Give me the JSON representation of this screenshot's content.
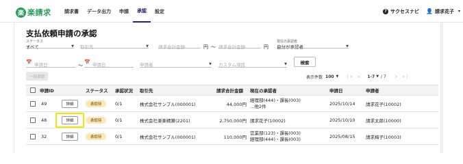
{
  "logo": {
    "mark": "楽",
    "text": "楽請求"
  },
  "nav": [
    {
      "label": "請求書",
      "active": false
    },
    {
      "label": "データ出力",
      "active": false
    },
    {
      "label": "申請",
      "active": false
    },
    {
      "label": "承認",
      "active": true
    },
    {
      "label": "設定",
      "active": false
    }
  ],
  "header_right": {
    "help_label": "サクセスナビ",
    "help_icon": "?",
    "user_name": "請求花子",
    "user_icon": "person-icon"
  },
  "page_title": "支払依頼申請の承認",
  "filters": {
    "status_label": "ステータス",
    "status_value": "すべて",
    "vendor_placeholder": "取引先",
    "amount_from_placeholder": "請求合計金額",
    "amount_to_placeholder": "請求合計金額",
    "yen": "円",
    "tilde": "〜",
    "approver_label": "現在の承認者",
    "approver_value": "自分が承認者",
    "date_from_placeholder": "申請日",
    "date_to_placeholder": "申請日",
    "applicant_placeholder": "申請者",
    "custom_placeholder": "カスタム項目",
    "search_label": "検索"
  },
  "bulk_approve_label": "一括承認",
  "pager": {
    "count_label": "表示件数",
    "count_value": "100",
    "range": "1-7",
    "total": "/ 7"
  },
  "table": {
    "headers": [
      "申請ID",
      "ステータス",
      "承認状況",
      "取引先",
      "請求合計金額",
      "現在の承認者",
      "申請日",
      "申請者"
    ],
    "detail_label": "詳細",
    "rows": [
      {
        "id": "49",
        "status": "承認待",
        "progress": "0/1",
        "vendor": "株式会社サンプル(000001)",
        "amount": "44,000円",
        "approver_lines": [
          "経理部(444)・課長(003)",
          "…他2件"
        ],
        "date": "2025/10/14",
        "applicant": "請求花子(10002)"
      },
      {
        "id": "48",
        "status": "承認待",
        "progress": "0/1",
        "vendor": "株式会社楽楽精算(2201)",
        "amount": "2,750,000円",
        "approver_lines": [
          "請求花子(10002)"
        ],
        "date": "2025/10/10",
        "applicant": "請求太郎(10000)"
      },
      {
        "id": "32",
        "status": "承認待",
        "progress": "0/1",
        "vendor": "株式会社サンプル(000001)",
        "amount": "110,000円",
        "approver_lines": [
          "営業部(123)・課長(003)",
          "経理部(444)・課長(003)"
        ],
        "date": "2025/08/15",
        "applicant": "請求梅子(10003)"
      }
    ]
  },
  "colors": {
    "brand": "#2a9d5c",
    "highlight": "#f2e600",
    "badge": "#fbe7b8"
  }
}
